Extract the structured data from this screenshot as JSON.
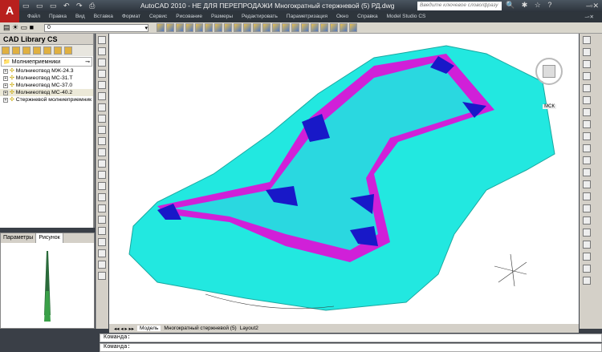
{
  "app": {
    "title": "AutoCAD 2010 - НЕ ДЛЯ ПЕРЕПРОДАЖИ    Многократный стержневой (5) РД.dwg",
    "logo": "A",
    "search_placeholder": "Введите ключевое слово/фразу"
  },
  "menu": [
    "Файл",
    "Правка",
    "Вид",
    "Вставка",
    "Формат",
    "Сервис",
    "Рисование",
    "Размеры",
    "Редактировать",
    "Параметризация",
    "Окно",
    "Справка",
    "Model Studio CS"
  ],
  "layer": {
    "value": "0"
  },
  "library": {
    "title": "CAD Library CS",
    "root": "Молниеприемники",
    "items": [
      "Молниеотвод МЖ-24.3",
      "Молниеотвод МС-31.Т",
      "Молниеотвод МС-37.0",
      "Молниеотвод МС-40.2",
      "Стержневой молниеприемник"
    ]
  },
  "lower_panel": {
    "tabs": [
      "Параметры",
      "Рисунок"
    ]
  },
  "layout_tabs": [
    "Модель",
    "Многократный стержневой (5)",
    "Layout2"
  ],
  "command": {
    "line1": "Команда:",
    "line2": "Команда:"
  },
  "viewcube": {
    "label": "МСК"
  },
  "colors": {
    "surface": "#22e8e0",
    "border": "#d020d8",
    "star": "#1818c8"
  }
}
